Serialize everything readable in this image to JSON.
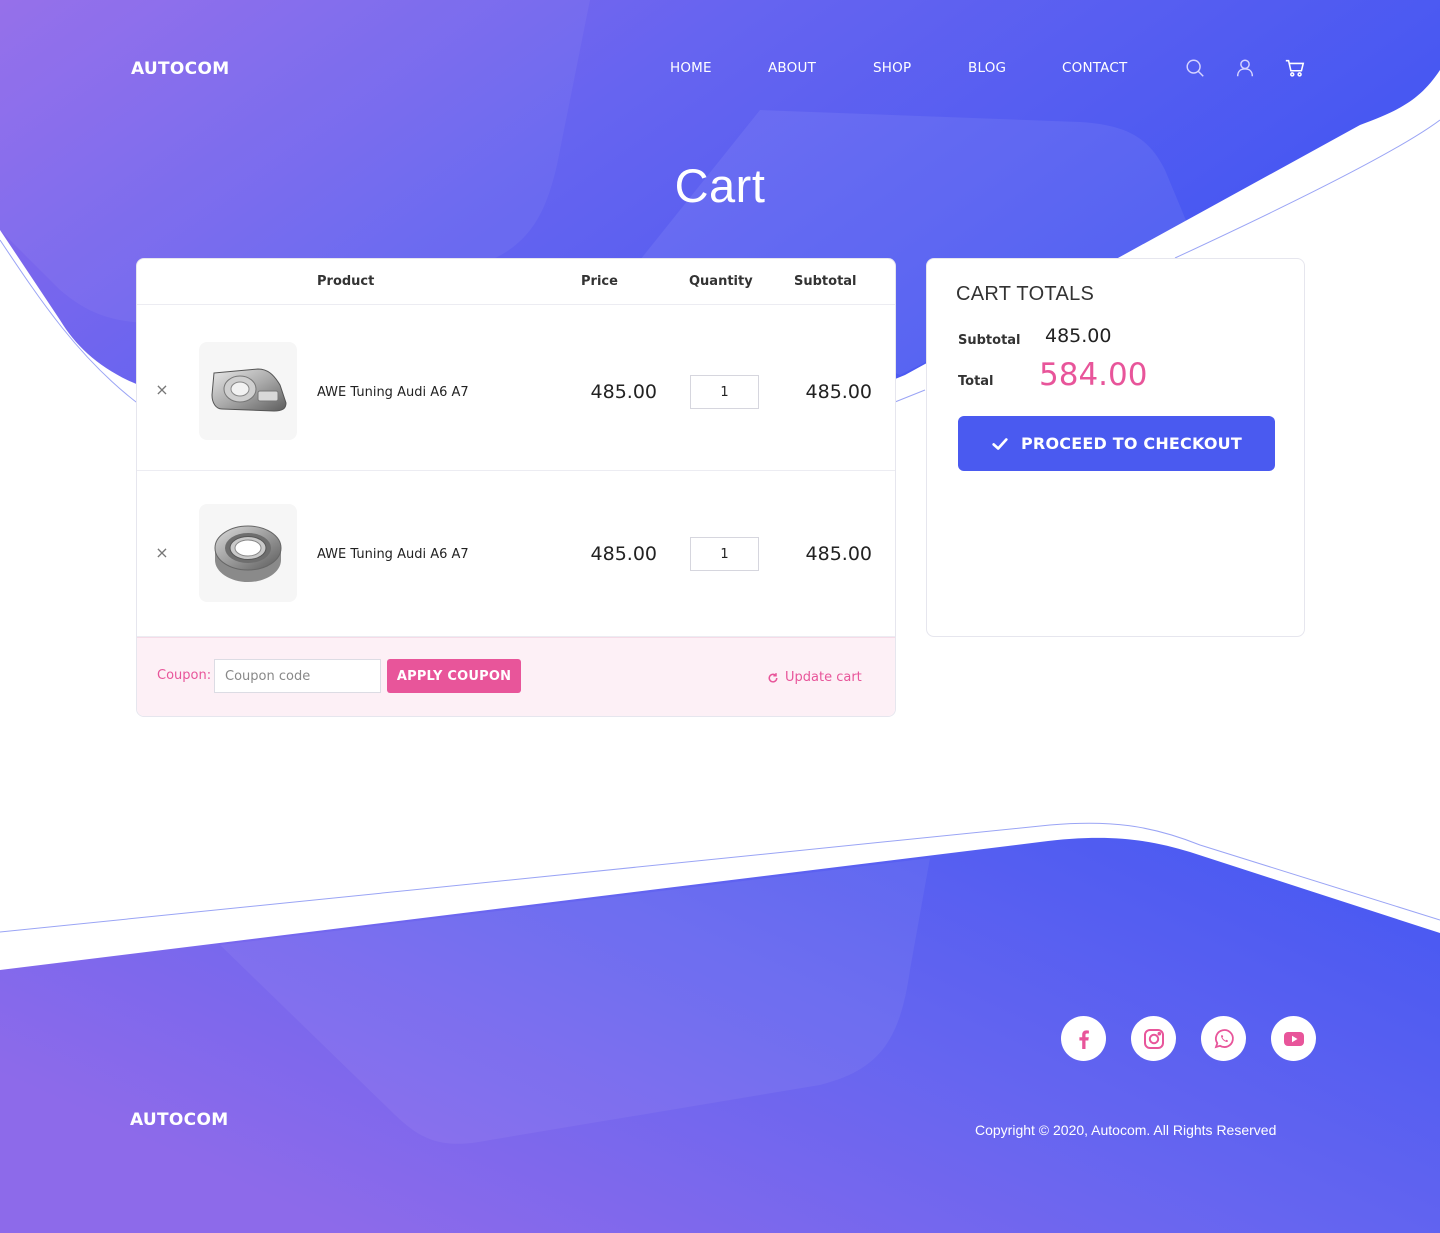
{
  "header": {
    "brand": "AUTOCOM",
    "nav": [
      {
        "label": "HOME"
      },
      {
        "label": "ABOUT"
      },
      {
        "label": "SHOP"
      },
      {
        "label": "BLOG"
      },
      {
        "label": "CONTACT"
      }
    ],
    "icons": [
      "search-icon",
      "user-icon",
      "cart-icon"
    ]
  },
  "page_title": "Cart",
  "cart": {
    "columns": {
      "product": "Product",
      "price": "Price",
      "quantity": "Quantity",
      "subtotal": "Subtotal"
    },
    "items": [
      {
        "name": "AWE Tuning Audi A6 A7",
        "price": "485.00",
        "quantity": "1",
        "subtotal": "485.00",
        "image": "headlight-image"
      },
      {
        "name": "AWE Tuning Audi A6 A7",
        "price": "485.00",
        "quantity": "1",
        "subtotal": "485.00",
        "image": "wheel-bearing-image"
      }
    ],
    "coupon": {
      "label": "Coupon:",
      "placeholder": "Coupon code",
      "apply_label": "APPLY COUPON"
    },
    "update_label": "Update cart"
  },
  "totals": {
    "title": "CART TOTALS",
    "subtotal_label": "Subtotal",
    "subtotal_value": "485.00",
    "total_label": "Total",
    "total_value": "584.00",
    "checkout_label": "PROCEED TO CHECKOUT"
  },
  "footer": {
    "brand": "AUTOCOM",
    "copyright": "Copyright © 2020, Autocom. All Rights Reserved",
    "social": [
      "facebook-icon",
      "instagram-icon",
      "whatsapp-icon",
      "youtube-icon"
    ]
  },
  "colors": {
    "accent_blue": "#4a5af0",
    "accent_pink": "#e8559a",
    "gradient_start": "#8f6ae8",
    "gradient_end": "#4457f2"
  }
}
